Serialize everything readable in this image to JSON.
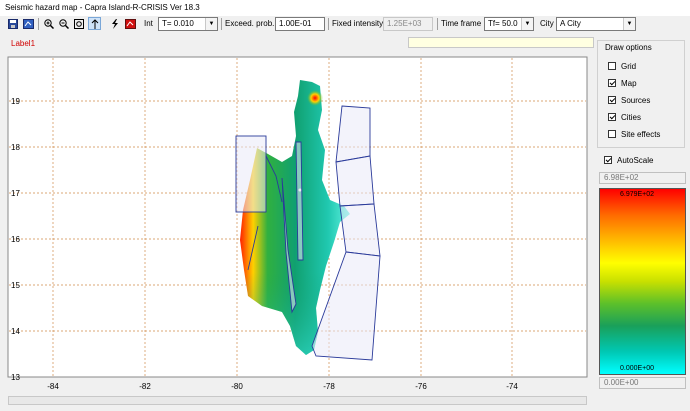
{
  "window": {
    "title": "Seismic hazard map - Capra Island-R-CRISIS Ver 18.3"
  },
  "toolbar": {
    "int_label": "Int",
    "int_value": "T= 0.010",
    "exceed_label": "Exceed. prob.",
    "exceed_value": "1.00E-01",
    "fixed_label": "Fixed intensity",
    "fixed_value": "1.25E+03",
    "timeframe_label": "Time frame",
    "timeframe_value": "Tf= 50.0",
    "city_label": "City",
    "city_value": "A City",
    "icons": [
      "save-icon",
      "map-icon",
      "zoom-in-icon",
      "zoom-out-icon",
      "zoom-extent-icon",
      "pan-up-icon",
      "lightning-icon",
      "red-map-icon"
    ]
  },
  "map": {
    "label": "Label1",
    "x_ticks": [
      "-84",
      "-82",
      "-80",
      "-78",
      "-76",
      "-74"
    ],
    "y_ticks": [
      "19",
      "18",
      "17",
      "16",
      "15",
      "14",
      "13"
    ]
  },
  "draw_options": {
    "title": "Draw options",
    "items": [
      {
        "label": "Grid",
        "checked": false
      },
      {
        "label": "Map",
        "checked": true
      },
      {
        "label": "Sources",
        "checked": true
      },
      {
        "label": "Cities",
        "checked": true
      },
      {
        "label": "Site effects",
        "checked": false
      }
    ]
  },
  "scale": {
    "autoscale_label": "AutoScale",
    "autoscale_checked": true,
    "max_box": "6.98E+02",
    "min_box": "0.00E+00",
    "bar_top": "6.979E+02",
    "bar_bottom": "0.000E+00"
  },
  "colors": {
    "grid": "#d08a4a",
    "sources": "#2a3a9a",
    "label": "#d00000"
  }
}
